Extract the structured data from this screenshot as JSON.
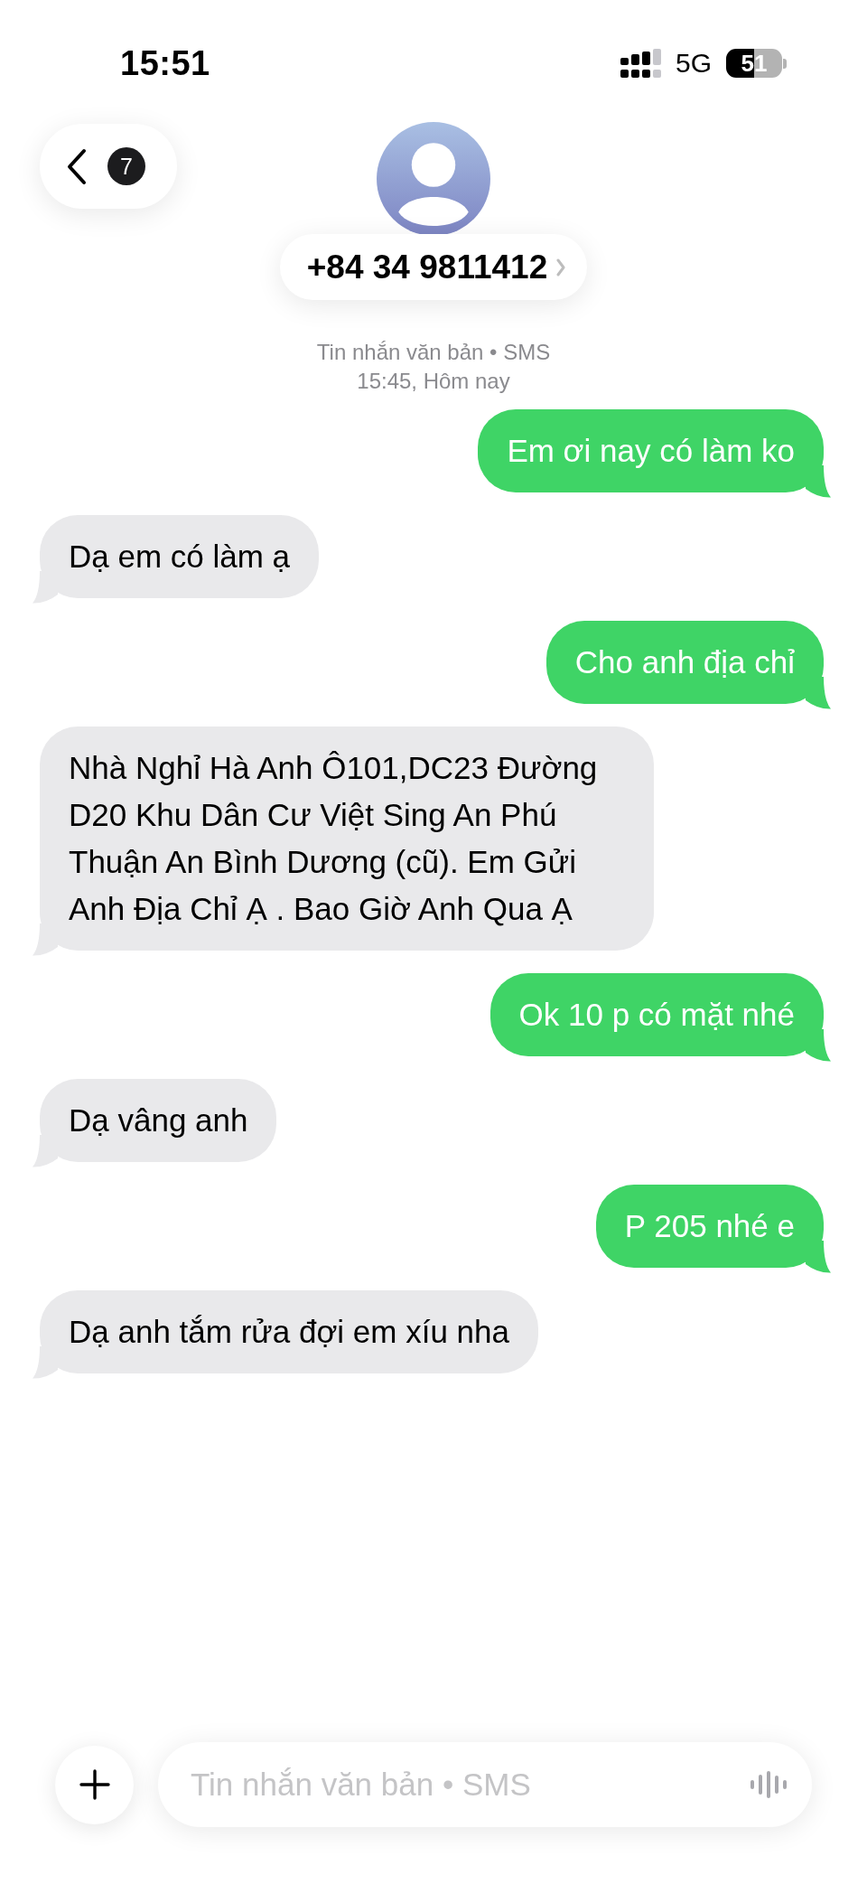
{
  "status_bar": {
    "time": "15:51",
    "network": "5G",
    "battery": "51"
  },
  "header": {
    "back_badge": "7",
    "contact": "+84 34 9811412"
  },
  "conversation_info": {
    "service": "Tin nhắn văn bản • SMS",
    "timestamp": "15:45, Hôm nay"
  },
  "messages": [
    {
      "kind": "sent",
      "text": "Em ơi nay có làm ko"
    },
    {
      "kind": "received",
      "text": "Dạ em có làm ạ"
    },
    {
      "kind": "sent",
      "text": "Cho anh địa chỉ"
    },
    {
      "kind": "received",
      "text": "Nhà Nghỉ Hà Anh Ô101,DC23 Đường D20 Khu Dân Cư Việt Sing An Phú Thuận An Bình Dương (cũ). Em Gửi Anh Địa Chỉ Ạ . Bao Giờ Anh Qua Ạ"
    },
    {
      "kind": "sent",
      "text": "Ok 10 p có mặt nhé"
    },
    {
      "kind": "received",
      "text": "Dạ vâng anh"
    },
    {
      "kind": "sent",
      "text": "P 205 nhé e"
    },
    {
      "kind": "received",
      "text": "Dạ anh tắm rửa đợi em xíu nha"
    }
  ],
  "composer": {
    "placeholder": "Tin nhắn văn bản • SMS"
  }
}
